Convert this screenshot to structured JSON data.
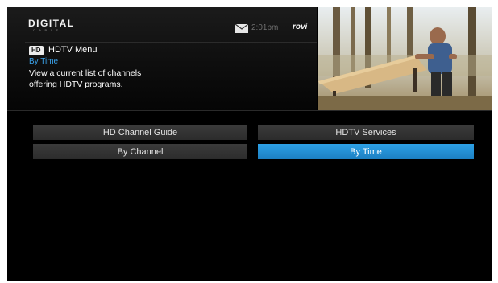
{
  "header": {
    "logo_text": "DIGITAL",
    "logo_sub": "CABLE",
    "time": "2:01pm",
    "brand": "rovi"
  },
  "menu": {
    "badge": "HD",
    "title": "HDTV Menu",
    "breadcrumb": "By Time",
    "description_line1": "View a current list of channels",
    "description_line2": "offering HDTV programs."
  },
  "buttons": {
    "hd_channel_guide": "HD Channel Guide",
    "hdtv_services": "HDTV Services",
    "by_channel": "By Channel",
    "by_time": "By Time"
  },
  "colors": {
    "selected": "#1e88cf",
    "accent_text": "#3aa0e8"
  },
  "icons": [
    "mail-icon"
  ]
}
